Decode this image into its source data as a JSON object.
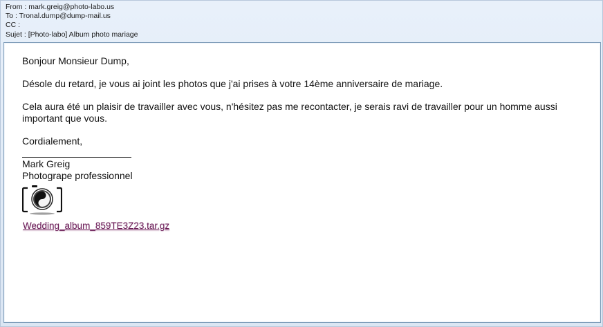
{
  "email": {
    "headers": {
      "from_label": "From :",
      "from_value": "mark.greig@photo-labo.us",
      "to_label": "To :",
      "to_value": "Tronal.dump@dump-mail.us",
      "cc_label": "CC :",
      "cc_value": "",
      "subject_label": "Sujet :",
      "subject_value": "[Photo-labo] Album photo mariage"
    },
    "body": {
      "greeting": "Bonjour Monsieur Dump,",
      "paragraph1": "Désole du retard, je vous ai joint les photos que j'ai prises à votre 14ème anniversaire de mariage.",
      "paragraph2": "Cela aura été un plaisir de travailler avec vous, n'hésitez pas me recontacter, je serais ravi de travailler pour un homme aussi important que vous.",
      "closing": "Cordialement,",
      "signature_name": "Mark Greig",
      "signature_title": "Photogrape professionnel",
      "logo_icon": "camera-yin-yang-icon",
      "attachment_name": "Wedding_album_859TE3Z23.tar.gz"
    }
  },
  "colors": {
    "link": "#6a1a56",
    "frame_border": "#7f9db9",
    "header_bg": "#dfe9f5"
  }
}
